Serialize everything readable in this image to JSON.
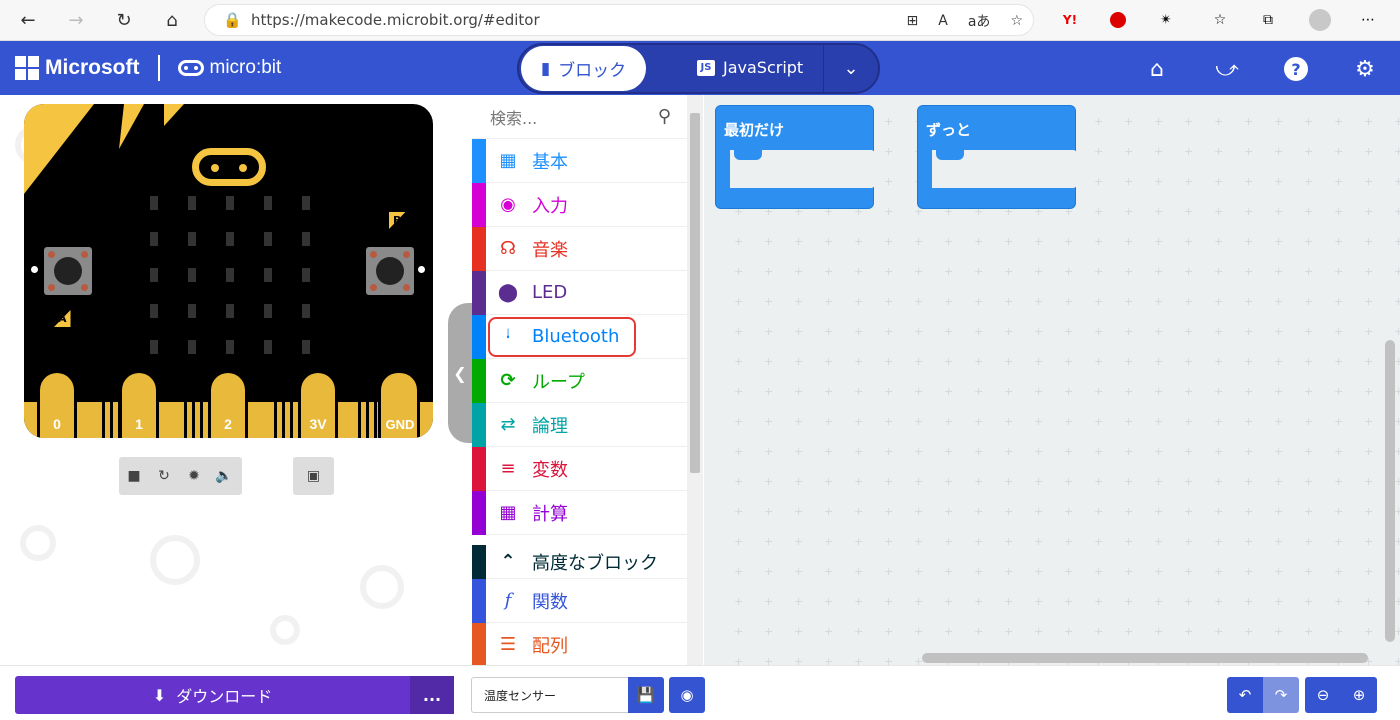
{
  "browser": {
    "url": "https://makecode.microbit.org/#editor",
    "read_aloud": "A",
    "translate": "aあ"
  },
  "header": {
    "brand": "Microsoft",
    "product": "micro:bit",
    "tab_blocks": "ブロック",
    "tab_javascript": "JavaScript",
    "js_badge": "JS",
    "accent_color": "#3454d1"
  },
  "simulator": {
    "button_a": "A",
    "button_b": "B",
    "pins": [
      "0",
      "1",
      "2",
      "3V",
      "GND"
    ]
  },
  "toolbox": {
    "search_placeholder": "検索...",
    "categories": [
      {
        "label": "基本",
        "icon": "grid-icon",
        "color": "#1e90ff"
      },
      {
        "label": "入力",
        "icon": "target-icon",
        "color": "#d400d4"
      },
      {
        "label": "音楽",
        "icon": "headphones-icon",
        "color": "#e63022"
      },
      {
        "label": "LED",
        "icon": "toggle-icon",
        "color": "#5c2d91"
      },
      {
        "label": "Bluetooth",
        "icon": "bluetooth-icon",
        "color": "#0082fb"
      },
      {
        "label": "ループ",
        "icon": "loop-icon",
        "color": "#00aa00"
      },
      {
        "label": "論理",
        "icon": "shuffle-icon",
        "color": "#00a4a6"
      },
      {
        "label": "変数",
        "icon": "lines-icon",
        "color": "#dc143c"
      },
      {
        "label": "計算",
        "icon": "calculator-icon",
        "color": "#9400d3"
      },
      {
        "label": "高度なブロック",
        "icon": "chevron-up-icon",
        "color": "#002b36"
      },
      {
        "label": "関数",
        "icon": "function-icon",
        "color": "#3455db"
      },
      {
        "label": "配列",
        "icon": "list-icon",
        "color": "#e65722"
      }
    ]
  },
  "workspace": {
    "block_on_start": "最初だけ",
    "block_forever": "ずっと"
  },
  "footer": {
    "download": "ダウンロード",
    "more": "...",
    "project_name": "温度センサー"
  }
}
